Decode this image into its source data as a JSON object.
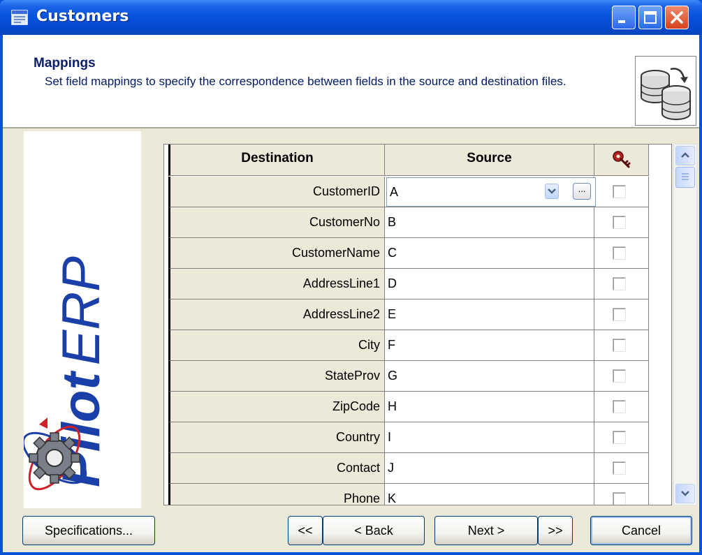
{
  "window": {
    "title": "Customers"
  },
  "header": {
    "title": "Mappings",
    "description": "Set field mappings to specify the correspondence between fields in the source and destination files."
  },
  "logo": {
    "brand_bold": "Pilot",
    "brand_light": "ERP"
  },
  "grid": {
    "columns": {
      "destination": "Destination",
      "source": "Source",
      "key_icon": "key-icon"
    },
    "rows": [
      {
        "destination": "CustomerID",
        "source": "A",
        "key": false
      },
      {
        "destination": "CustomerNo",
        "source": "B",
        "key": false
      },
      {
        "destination": "CustomerName",
        "source": "C",
        "key": false
      },
      {
        "destination": "AddressLine1",
        "source": "D",
        "key": false
      },
      {
        "destination": "AddressLine2",
        "source": "E",
        "key": false
      },
      {
        "destination": "City",
        "source": "F",
        "key": false
      },
      {
        "destination": "StateProv",
        "source": "G",
        "key": false
      },
      {
        "destination": "ZipCode",
        "source": "H",
        "key": false
      },
      {
        "destination": "Country",
        "source": "I",
        "key": false
      },
      {
        "destination": "Contact",
        "source": "J",
        "key": false
      },
      {
        "destination": "Phone",
        "source": "K",
        "key": false
      }
    ],
    "editor": {
      "value": "A",
      "ellipsis": "..."
    }
  },
  "buttons": {
    "specifications": "Specifications...",
    "first": "<<",
    "back": "< Back",
    "next": "Next >",
    "last": ">>",
    "cancel": "Cancel"
  },
  "colors": {
    "title_bar": "#0651de",
    "dialog_bg": "#ece9d8",
    "brand_blue": "#1a3fa8",
    "brand_red": "#d0202a"
  }
}
